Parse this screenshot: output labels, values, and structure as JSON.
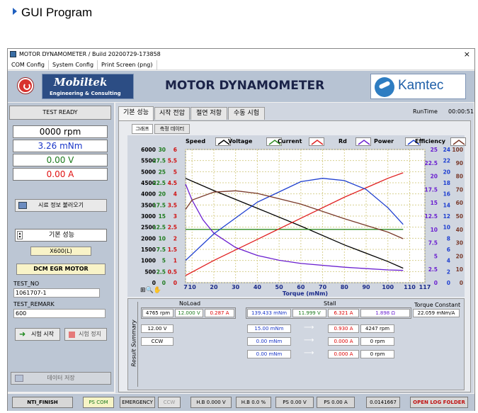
{
  "heading": "GUI Program",
  "window": {
    "title": "MOTOR DYNAMOMETER / Build 20200729-173858",
    "close": "×"
  },
  "menu": [
    "COM Config",
    "System Config",
    "Print Screen (png)"
  ],
  "banner": {
    "logo_main": "Mobiltek",
    "logo_sub": "Engineering & Consulting",
    "title": "MOTOR DYNAMOMETER",
    "partner": "Kamtec"
  },
  "left": {
    "status": "TEST READY",
    "rpm": "0000 rpm",
    "torque": "3.26 mNm",
    "voltage": "0.00 V",
    "current": "0.00 A",
    "load_info_btn": "시료 정보 불러오기",
    "test_mode": "기본 성능",
    "model": "X600(L)",
    "motor": "DCM EGR MOTOR",
    "test_no_label": "TEST_NO",
    "test_no": "1061707-1",
    "test_remark_label": "TEST_REMARK",
    "test_remark": "600",
    "start_btn": "시험 시작",
    "stop_btn": "시험 정지",
    "save_btn": "데이터 저장"
  },
  "tabs": [
    "기본 성능",
    "시작 전압",
    "절연 저항",
    "수동 시험"
  ],
  "runtime_label": "RunTime",
  "runtime": "00:00:51",
  "subtabs": [
    "그래프",
    "측정 데이터"
  ],
  "legend": [
    {
      "name": "Speed",
      "color": "#000000"
    },
    {
      "name": "Voltage",
      "color": "#2e8b22"
    },
    {
      "name": "Current",
      "color": "#e02020"
    },
    {
      "name": "Rd",
      "color": "#6a1fd0"
    },
    {
      "name": "Power",
      "color": "#1e3fd0"
    },
    {
      "name": "Efficiency",
      "color": "#7a3a2a"
    }
  ],
  "chart_data": {
    "type": "line",
    "xlabel": "Torque (mNm)",
    "x_ticks": [
      "7",
      "10",
      "20",
      "30",
      "40",
      "50",
      "60",
      "70",
      "80",
      "90",
      "100",
      "110",
      "117"
    ],
    "xlim": [
      7,
      117
    ],
    "y_axes": [
      {
        "name": "Speed",
        "ticks": [
          "0",
          "500",
          "1000",
          "1500",
          "2000",
          "2500",
          "3000",
          "3500",
          "4000",
          "4500",
          "5000",
          "5500",
          "6000"
        ],
        "range": [
          0,
          6000
        ]
      },
      {
        "name": "Voltage",
        "ticks": [
          "0",
          "2.5",
          "5",
          "7.5",
          "10",
          "12.5",
          "15",
          "17.5",
          "20",
          "22.5",
          "25",
          "27.5",
          "30"
        ],
        "range": [
          0,
          30
        ]
      },
      {
        "name": "Current",
        "ticks": [
          "0",
          "0.5",
          "1",
          "1.5",
          "2",
          "2.5",
          "3",
          "3.5",
          "4",
          "4.5",
          "5",
          "5.5",
          "6"
        ],
        "range": [
          0,
          6
        ]
      },
      {
        "name": "Rd",
        "ticks": [
          "0",
          "2.5",
          "5",
          "7.5",
          "10",
          "12.5",
          "15",
          "17.5",
          "20",
          "22.5",
          "25"
        ],
        "range": [
          0,
          25
        ]
      },
      {
        "name": "Power",
        "ticks": [
          "0",
          "2",
          "4",
          "6",
          "8",
          "10",
          "12",
          "14",
          "16",
          "18",
          "20",
          "22",
          "24"
        ],
        "range": [
          0,
          24
        ]
      },
      {
        "name": "Efficiency",
        "ticks": [
          "0",
          "10",
          "20",
          "30",
          "40",
          "50",
          "60",
          "70",
          "80",
          "90",
          "100"
        ],
        "range": [
          0,
          100
        ]
      }
    ],
    "series": [
      {
        "name": "Speed",
        "x": [
          7,
          20,
          40,
          60,
          80,
          100,
          107
        ],
        "y": [
          4700,
          4150,
          3350,
          2550,
          1700,
          950,
          650
        ]
      },
      {
        "name": "Voltage",
        "x": [
          7,
          107
        ],
        "y": [
          12,
          12
        ]
      },
      {
        "name": "Current",
        "x": [
          7,
          20,
          40,
          60,
          80,
          100,
          107
        ],
        "y": [
          0.32,
          1.0,
          1.95,
          2.9,
          3.85,
          4.7,
          4.95
        ]
      },
      {
        "name": "Rd",
        "x": [
          7,
          10,
          15,
          20,
          30,
          40,
          50,
          60,
          80,
          100,
          107
        ],
        "y": [
          18.5,
          15.5,
          11.8,
          9.3,
          6.6,
          5.1,
          4.2,
          3.6,
          2.9,
          2.4,
          2.3
        ]
      },
      {
        "name": "Power",
        "x": [
          7,
          20,
          40,
          60,
          70,
          80,
          90,
          100,
          107
        ],
        "y": [
          4,
          8.8,
          14.5,
          18.2,
          18.8,
          18.4,
          16.8,
          13.5,
          10.5
        ]
      },
      {
        "name": "Efficiency",
        "x": [
          7,
          10,
          20,
          30,
          40,
          60,
          80,
          100,
          107
        ],
        "y": [
          55,
          62,
          68,
          69,
          67,
          59,
          48,
          38,
          33
        ]
      }
    ]
  },
  "result": {
    "title": "Result Summary",
    "noload_label": "NoLoad",
    "stall_label": "Stall",
    "torque_const_label": "Torque Constant",
    "noload": [
      "4765 rpm",
      "12.000 V",
      "0.287 A"
    ],
    "stall": [
      "139.433 mNm",
      "11.999 V",
      "6.321 A",
      "1.898 Ω"
    ],
    "torque_const": "22.059 mNm/A",
    "v_set": "12.00 V",
    "direction": "CCW",
    "rows": [
      {
        "torque": "15.00 mNm",
        "current": "0.930 A",
        "speed": "4247 rpm"
      },
      {
        "torque": "0.00 mNm",
        "current": "0.000 A",
        "speed": "0 rpm"
      },
      {
        "torque": "0.00 mNm",
        "current": "0.000 A",
        "speed": "0 rpm"
      }
    ]
  },
  "bottom": [
    "NTI_FINISH",
    "PS COM",
    "EMERGENCY",
    "CCW",
    "H.B 0.000 V",
    "H.B 0.0 %",
    "PS 0.00 V",
    "PS 0.00 A",
    "0.0141667",
    "OPEN LOG FOLDER"
  ]
}
